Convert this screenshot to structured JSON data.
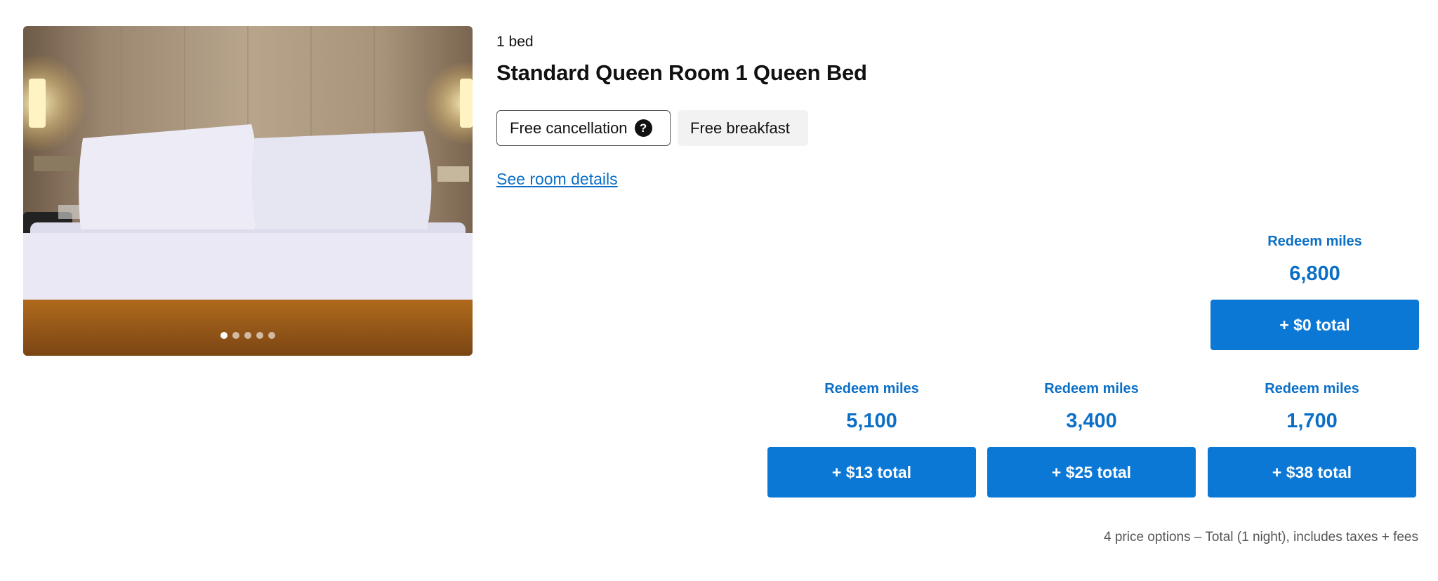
{
  "room": {
    "bed_count": "1 bed",
    "title": "Standard Queen Room 1 Queen Bed",
    "amenities": {
      "cancellation": "Free cancellation",
      "cancellation_help_icon": "question-circle-icon",
      "breakfast": "Free breakfast"
    },
    "details_link": "See room details"
  },
  "gallery": {
    "dot_count": 5,
    "active_dot": 1
  },
  "price_options": [
    {
      "label": "Redeem miles",
      "miles": "6,800",
      "button": "+ $0 total"
    },
    {
      "label": "Redeem miles",
      "miles": "5,100",
      "button": "+ $13 total"
    },
    {
      "label": "Redeem miles",
      "miles": "3,400",
      "button": "+ $25 total"
    },
    {
      "label": "Redeem miles",
      "miles": "1,700",
      "button": "+ $38 total"
    }
  ],
  "footnote": "4 price options – Total (1 night), includes taxes + fees",
  "colors": {
    "accent": "#0b6fc6",
    "button": "#0b78d6",
    "chip_background": "#f2f2f2"
  }
}
